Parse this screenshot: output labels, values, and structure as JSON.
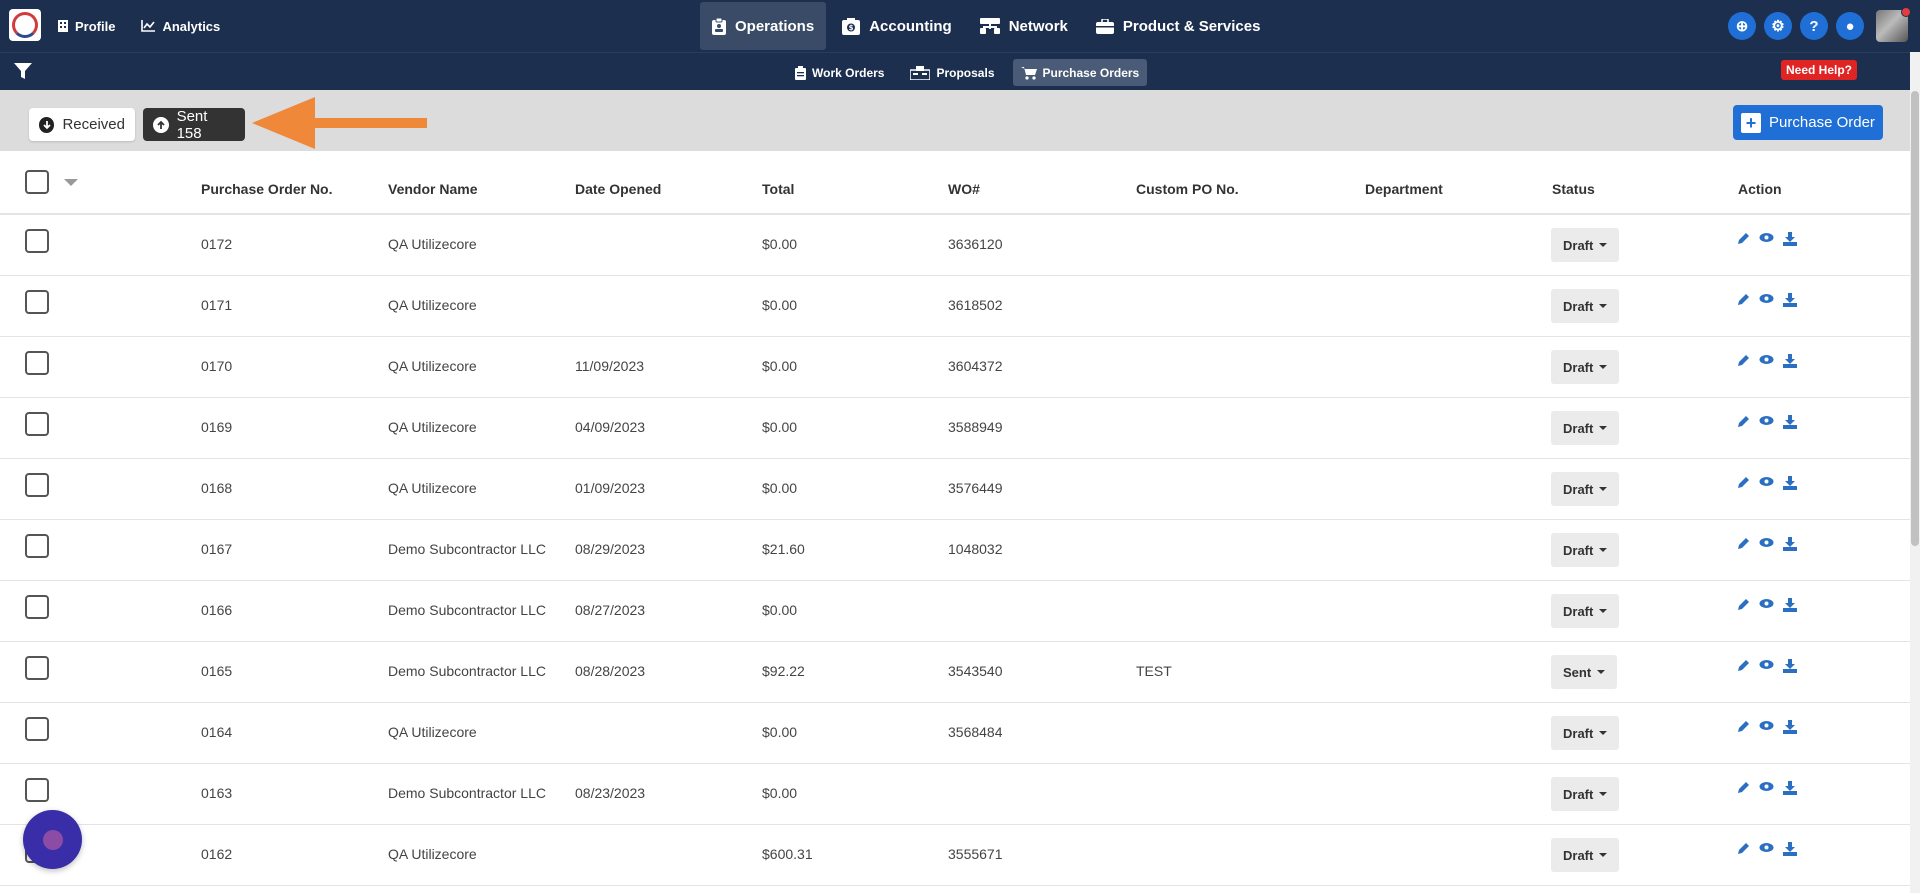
{
  "nav": {
    "left": [
      {
        "label": "Profile",
        "icon": "building-icon"
      },
      {
        "label": "Analytics",
        "icon": "chart-line-icon"
      }
    ],
    "center": [
      {
        "label": "Operations",
        "icon": "clipboard-icon"
      },
      {
        "label": "Accounting",
        "icon": "dollar-box-icon"
      },
      {
        "label": "Network",
        "icon": "network-icon"
      },
      {
        "label": "Product & Services",
        "icon": "briefcase-icon"
      }
    ],
    "right_icons": [
      "download-circle-icon",
      "gear-icon",
      "question-icon",
      "chat-icon"
    ],
    "right_glyphs": [
      "⊕",
      "⚙",
      "?",
      "●"
    ]
  },
  "subnav": {
    "items": [
      {
        "label": "Work Orders",
        "icon": "clipboard-icon"
      },
      {
        "label": "Proposals",
        "icon": "proposals-icon"
      },
      {
        "label": "Purchase Orders",
        "icon": "cart-icon"
      }
    ],
    "help": "Need Help?"
  },
  "tabs": {
    "received": "Received",
    "sent": "Sent 158"
  },
  "actions": {
    "purchase_order": "Purchase Order"
  },
  "table": {
    "headers": [
      "Purchase Order No.",
      "Vendor Name",
      "Date Opened",
      "Total",
      "WO#",
      "Custom PO No.",
      "Department",
      "Status",
      "Action"
    ],
    "rows": [
      {
        "po": "0172",
        "vendor": "QA Utilizecore",
        "date": "",
        "total": "$0.00",
        "wo": "3636120",
        "custom": "",
        "dept": "",
        "status": "Draft"
      },
      {
        "po": "0171",
        "vendor": "QA Utilizecore",
        "date": "",
        "total": "$0.00",
        "wo": "3618502",
        "custom": "",
        "dept": "",
        "status": "Draft"
      },
      {
        "po": "0170",
        "vendor": "QA Utilizecore",
        "date": "11/09/2023",
        "total": "$0.00",
        "wo": "3604372",
        "custom": "",
        "dept": "",
        "status": "Draft"
      },
      {
        "po": "0169",
        "vendor": "QA Utilizecore",
        "date": "04/09/2023",
        "total": "$0.00",
        "wo": "3588949",
        "custom": "",
        "dept": "",
        "status": "Draft"
      },
      {
        "po": "0168",
        "vendor": "QA Utilizecore",
        "date": "01/09/2023",
        "total": "$0.00",
        "wo": "3576449",
        "custom": "",
        "dept": "",
        "status": "Draft"
      },
      {
        "po": "0167",
        "vendor": "Demo Subcontractor LLC",
        "date": "08/29/2023",
        "total": "$21.60",
        "wo": "1048032",
        "custom": "",
        "dept": "",
        "status": "Draft"
      },
      {
        "po": "0166",
        "vendor": "Demo Subcontractor LLC",
        "date": "08/27/2023",
        "total": "$0.00",
        "wo": "",
        "custom": "",
        "dept": "",
        "status": "Draft"
      },
      {
        "po": "0165",
        "vendor": "Demo Subcontractor LLC",
        "date": "08/28/2023",
        "total": "$92.22",
        "wo": "3543540",
        "custom": "TEST",
        "dept": "",
        "status": "Sent"
      },
      {
        "po": "0164",
        "vendor": "QA Utilizecore",
        "date": "",
        "total": "$0.00",
        "wo": "3568484",
        "custom": "",
        "dept": "",
        "status": "Draft"
      },
      {
        "po": "0163",
        "vendor": "Demo Subcontractor LLC",
        "date": "08/23/2023",
        "total": "$0.00",
        "wo": "",
        "custom": "",
        "dept": "",
        "status": "Draft"
      },
      {
        "po": "0162",
        "vendor": "QA Utilizecore",
        "date": "",
        "total": "$600.31",
        "wo": "3555671",
        "custom": "",
        "dept": "",
        "status": "Draft"
      }
    ],
    "row_action_icons": [
      "pencil-icon",
      "eye-icon",
      "download-tray-icon"
    ]
  },
  "colors": {
    "navbar": "#1c2f4e",
    "primary": "#1f6fd6",
    "help_badge": "#e02424",
    "annotation_arrow": "#f0883a",
    "sent_tab": "#333333"
  }
}
